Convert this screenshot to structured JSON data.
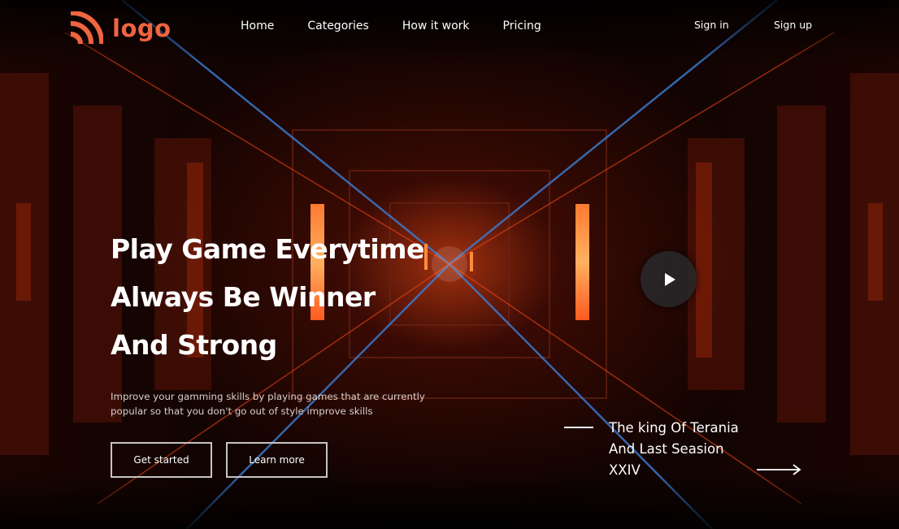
{
  "header": {
    "logo_text": "logo",
    "nav": [
      "Home",
      "Categories",
      "How it work",
      "Pricing"
    ],
    "sign_in": "Sign in",
    "sign_up": "Sign up"
  },
  "hero": {
    "headline": [
      "Play Game Everytime",
      "Always Be Winner",
      "And Strong"
    ],
    "subtext": "Improve your gamming skills by playing games that are currently popular so that you don't go out of style improve skills",
    "primary_button": "Get started",
    "secondary_button": "Learn more"
  },
  "feature": {
    "title_lines": [
      "The king Of Terania",
      "And Last Seasion",
      "XXIV"
    ]
  },
  "icons": {
    "logo": "signal-arcs-icon",
    "play": "play-icon",
    "arrow": "arrow-right-icon"
  },
  "colors": {
    "brand": "#f0643f",
    "background": "#0a0303",
    "text": "#ffffff"
  }
}
